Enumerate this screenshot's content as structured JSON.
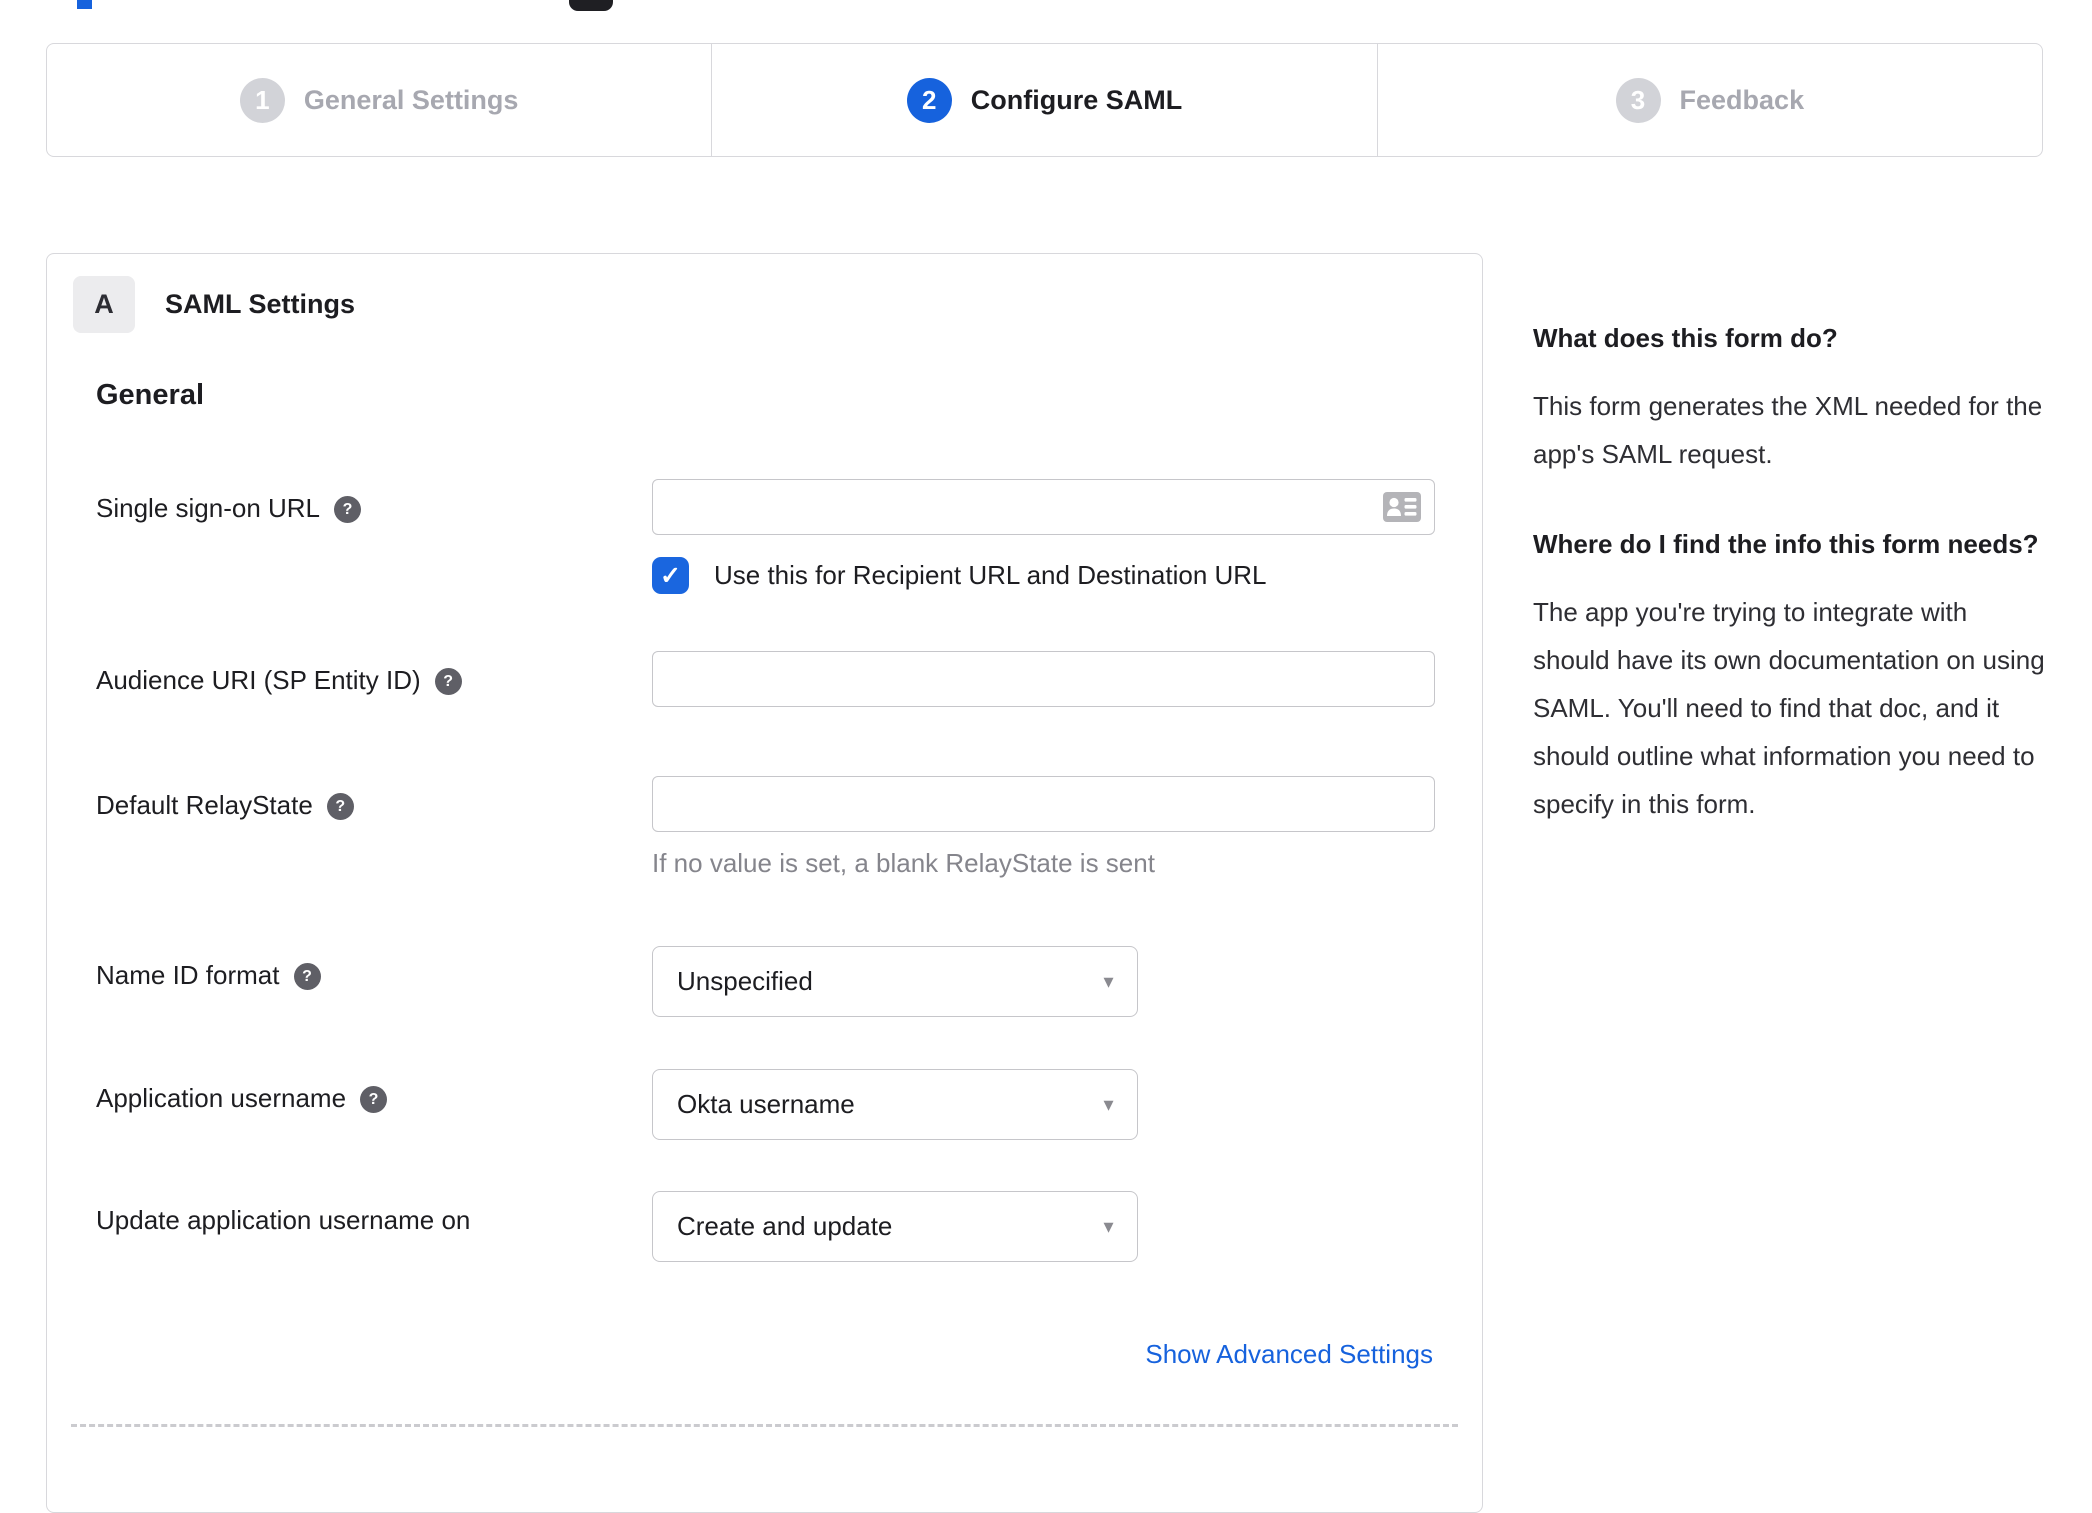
{
  "stepper": {
    "steps": [
      {
        "number": "1",
        "label": "General Settings",
        "state": "inactive"
      },
      {
        "number": "2",
        "label": "Configure SAML",
        "state": "active"
      },
      {
        "number": "3",
        "label": "Feedback",
        "state": "inactive"
      }
    ]
  },
  "card": {
    "badge": "A",
    "title": "SAML Settings",
    "general_heading": "General"
  },
  "fields": {
    "sso": {
      "label": "Single sign-on URL",
      "value": ""
    },
    "sso_checkbox": {
      "label": "Use this for Recipient URL and Destination URL",
      "checked": true
    },
    "audience": {
      "label": "Audience URI (SP Entity ID)",
      "value": ""
    },
    "relay": {
      "label": "Default RelayState",
      "value": "",
      "helper": "If no value is set, a blank RelayState is sent"
    },
    "name_id": {
      "label": "Name ID format",
      "value": "Unspecified"
    },
    "app_username": {
      "label": "Application username",
      "value": "Okta username"
    },
    "update_username": {
      "label": "Update application username on",
      "value": "Create and update"
    }
  },
  "advanced": {
    "label": "Show Advanced Settings"
  },
  "help_panel": {
    "q1": {
      "title": "What does this form do?",
      "body": "This form generates the XML needed for the app's SAML request."
    },
    "q2": {
      "title": "Where do I find the info this form needs?",
      "body": "The app you're trying to integrate with should have its own documentation on using SAML. You'll need to find that doc, and it should outline what information you need to specify in this form."
    }
  },
  "glyphs": {
    "help": "?",
    "check": "✓",
    "caret": "▼"
  },
  "colors": {
    "accent_blue": "#1662dd",
    "checkbox_blue": "#1a66df",
    "inactive_gray": "#d2d3d8",
    "border_gray": "#d8d8dc",
    "helper_gray": "#85858c"
  }
}
